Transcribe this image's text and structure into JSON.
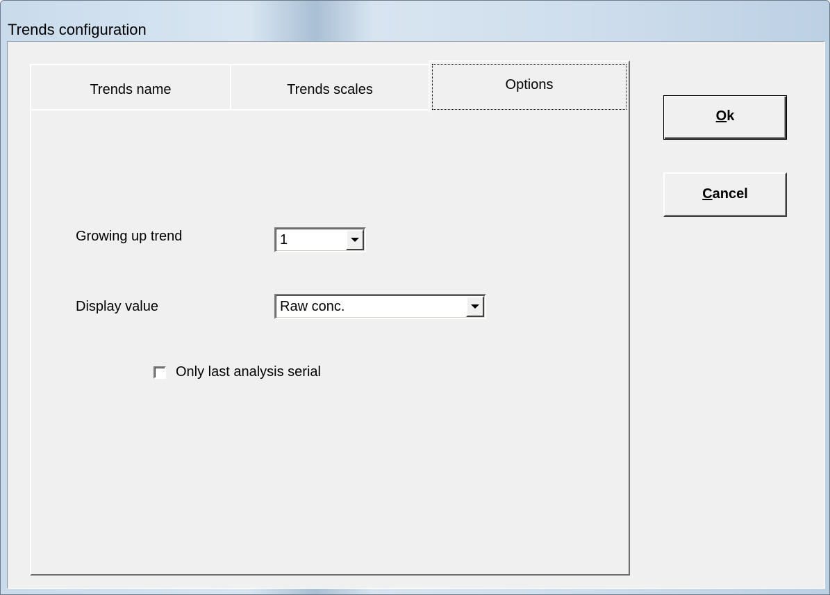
{
  "window": {
    "title": "Trends configuration"
  },
  "tabs": [
    {
      "label": "Trends name",
      "selected": false
    },
    {
      "label": "Trends scales",
      "selected": false
    },
    {
      "label": "Options",
      "selected": true
    }
  ],
  "options": {
    "growing_up_trend": {
      "label": "Growing up trend",
      "value": "1"
    },
    "display_value": {
      "label": "Display value",
      "value": "Raw conc."
    },
    "only_last_serial": {
      "label": "Only last analysis serial",
      "checked": false
    }
  },
  "buttons": {
    "ok": {
      "label": "Ok",
      "mnemonic": "O"
    },
    "cancel": {
      "label": "Cancel",
      "mnemonic": "C"
    }
  },
  "icons": {
    "dropdown": "chevron-down-icon"
  }
}
